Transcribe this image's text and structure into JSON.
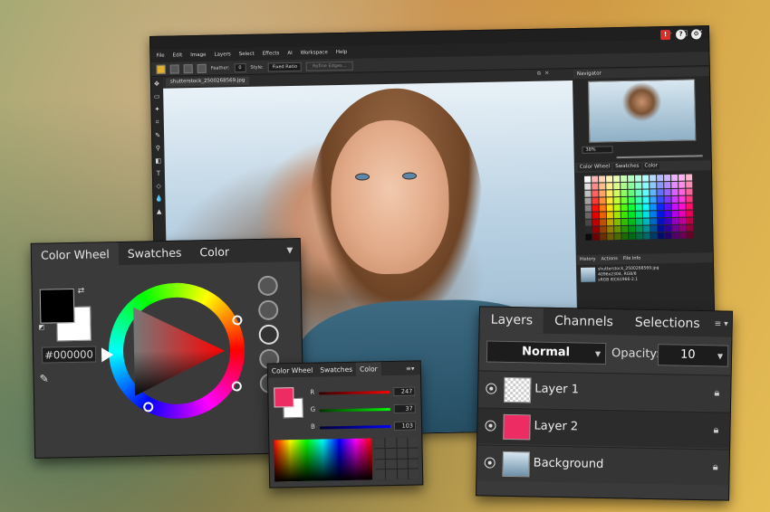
{
  "app": {
    "menus": [
      "File",
      "Edit",
      "Image",
      "Layers",
      "Select",
      "Effects",
      "AI",
      "Workspace",
      "Help"
    ],
    "options": {
      "feather_label": "Feather:",
      "feather_value": "0",
      "style_label": "Style:",
      "style_value": "Fixed Ratio",
      "refine_label": "Refine Edges..."
    },
    "doc_tab": "shutterstock_2500268569.jpg",
    "navigator_title": "Navigator",
    "zoom": "38%",
    "swatch_tabs": [
      "Color Wheel",
      "Swatches",
      "Color"
    ],
    "history_tabs": [
      "History",
      "Actions",
      "File Info"
    ],
    "history_info": [
      "shutterstock_2500268569.jpg",
      "4096x2304, RGB/8",
      "sRGB IEC61966-2.1"
    ]
  },
  "color_wheel_panel": {
    "tabs": [
      "Color Wheel",
      "Swatches",
      "Color"
    ],
    "hex_value": "#000000",
    "foreground": "#000000",
    "background": "#ffffff"
  },
  "color_panel": {
    "tabs": [
      "Color Wheel",
      "Swatches",
      "Color"
    ],
    "swatch": "#ee2c64",
    "channels": [
      {
        "label": "R",
        "value": "247"
      },
      {
        "label": "G",
        "value": "37"
      },
      {
        "label": "B",
        "value": "103"
      }
    ]
  },
  "layers_panel": {
    "tabs": [
      "Layers",
      "Channels",
      "Selections"
    ],
    "blend_mode": "Normal",
    "opacity_label": "Opacity:",
    "opacity_value": "10",
    "layers": [
      {
        "name": "Layer 1"
      },
      {
        "name": "Layer 2",
        "fill": "#ee2c64"
      },
      {
        "name": "Background"
      }
    ]
  }
}
